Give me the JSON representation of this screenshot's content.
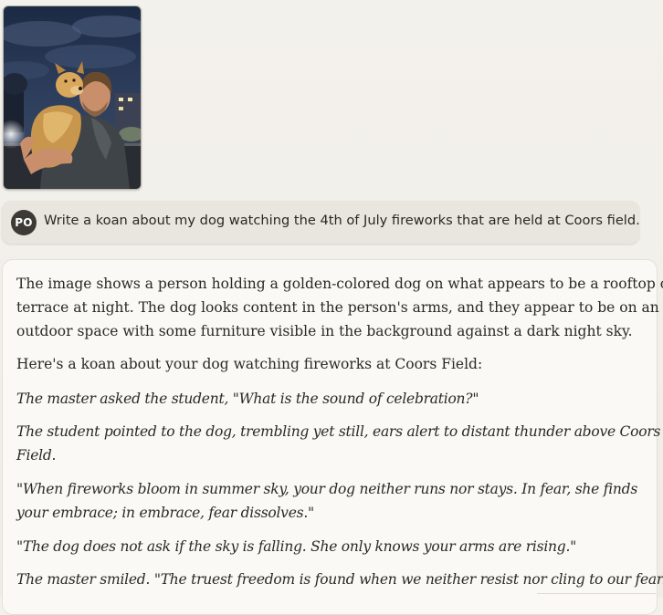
{
  "attachment": {
    "icon": "photo-thumbnail"
  },
  "user_message": {
    "avatar_initials": "PO",
    "text": "Write a koan about my dog watching the 4th of July fireworks that are held at Coors field."
  },
  "assistant_message": {
    "intro_lines": [
      "The image shows a person holding a golden-colored dog on what appears to be a rooftop or",
      "terrace at night. The dog looks content in the person's arms, and they appear to be on an",
      "outdoor space with some furniture visible in the background against a dark night sky."
    ],
    "lead": "Here's a koan about your dog watching fireworks at Coors Field:",
    "koan_1": "The master asked the student, \"What is the sound of celebration?\"",
    "koan_2_lines": [
      "The student pointed to the dog, trembling yet still, ears alert to distant thunder above Coors",
      "Field."
    ],
    "koan_3_lines": [
      "\"When fireworks bloom in summer sky, your dog neither runs nor stays. In fear, she finds",
      "your embrace; in embrace, fear dissolves.\""
    ],
    "koan_4": "\"The dog does not ask if the sky is falling. She only knows your arms are rising.\"",
    "koan_5": "The master smiled. \"The truest freedom is found when we neither resist nor cling to our fear.\""
  }
}
